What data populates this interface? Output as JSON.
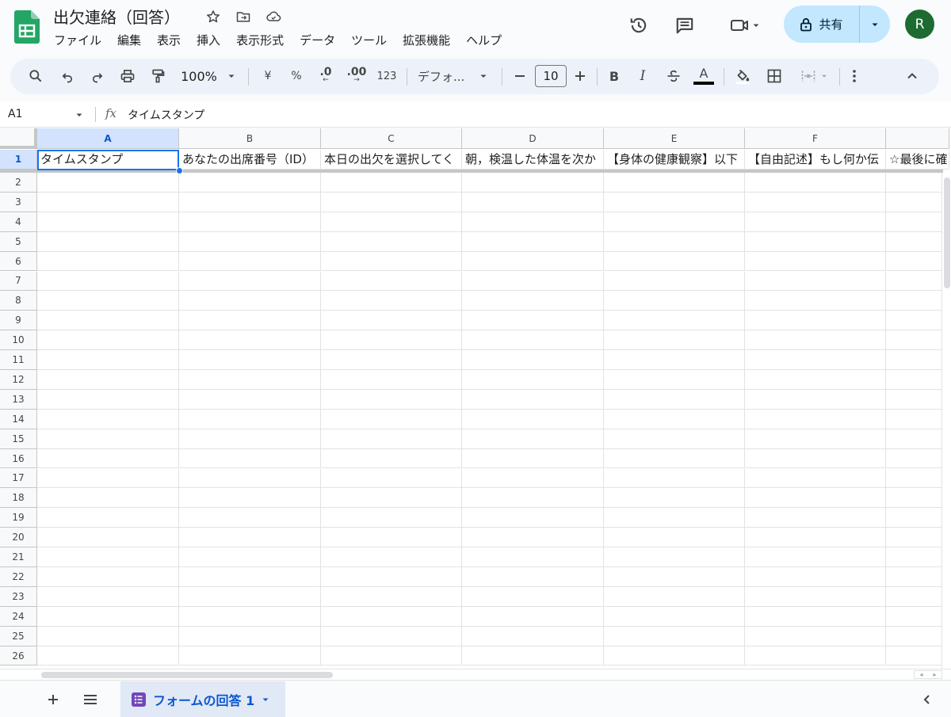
{
  "doc": {
    "title": "出欠連絡（回答）",
    "menu": [
      "ファイル",
      "編集",
      "表示",
      "挿入",
      "表示形式",
      "データ",
      "ツール",
      "拡張機能",
      "ヘルプ"
    ]
  },
  "header": {
    "share_label": "共有",
    "avatar_initial": "R"
  },
  "toolbar": {
    "zoom": "100%",
    "currency": "¥",
    "percent": "%",
    "decrease_decimals": ".0",
    "increase_decimals": ".00",
    "number_format": "123",
    "font": "デフォ...",
    "font_size": "10",
    "bold": "B",
    "italic": "I",
    "text_color": "A"
  },
  "formula_bar": {
    "cell_ref": "A1",
    "fx": "fx",
    "content": "タイムスタンプ"
  },
  "grid": {
    "columns": [
      "A",
      "B",
      "C",
      "D",
      "E",
      "F"
    ],
    "row_numbers": [
      "1",
      "2",
      "3",
      "4",
      "5",
      "6",
      "7",
      "8",
      "9",
      "10",
      "11",
      "12",
      "13",
      "14",
      "15",
      "16",
      "17",
      "18",
      "19",
      "20",
      "21",
      "22",
      "23",
      "24",
      "25",
      "26"
    ],
    "header_row": [
      "タイムスタンプ",
      "あなたの出席番号（ID）",
      "本日の出欠を選択してく",
      "朝，検温した体温を次か",
      "【身体の健康観察】以下",
      "【自由記述】もし何か伝",
      "☆最後に確"
    ],
    "selected_cell": "A1"
  },
  "sheets": [
    {
      "label": "フォームの回答 1",
      "active": true
    }
  ]
}
